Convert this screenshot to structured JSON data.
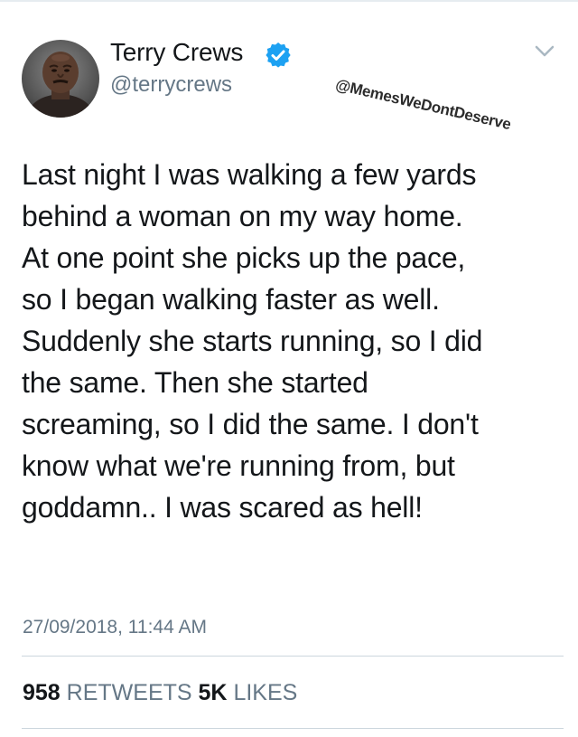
{
  "tweet": {
    "author": {
      "display_name": "Terry Crews",
      "handle": "@terrycrews",
      "verified": true
    },
    "watermark": "@MemesWeDontDeserve",
    "text": "Last night I was walking a few yards\nbehind a woman on my way home.\nAt one point she picks up the pace,\nso I began walking faster as well.\nSuddenly she starts running, so I did\nthe same. Then she started\nscreaming, so I did the same. I don't\nknow what we're running from, but\ngoddamn.. I was scared as hell!",
    "timestamp": "27/09/2018, 11:44 AM",
    "stats": {
      "retweets_count": "958",
      "retweets_label": "RETWEETS",
      "likes_count": "5K",
      "likes_label": "LIKES"
    }
  },
  "colors": {
    "text_primary": "#14171a",
    "text_secondary": "#657786",
    "verified_blue": "#1da1f2",
    "divider": "#ccd6dd"
  },
  "icons": {
    "verified": "verified-badge-icon",
    "menu": "chevron-down-icon",
    "avatar": "avatar"
  }
}
